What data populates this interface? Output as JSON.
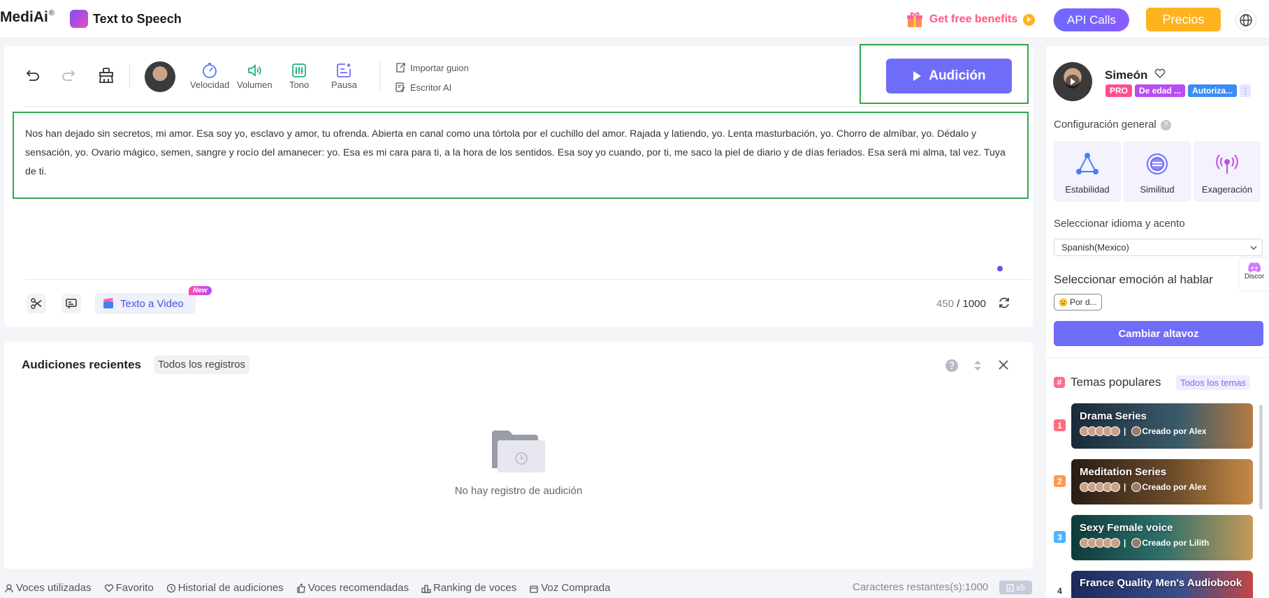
{
  "topbar": {
    "brand": "MediAi",
    "brand_reg": "®",
    "product": "Text to Speech",
    "benefits": "Get free benefits",
    "api_calls": "API Calls",
    "precios": "Precios"
  },
  "toolbar": {
    "velocidad": "Velocidad",
    "volumen": "Volumen",
    "tono": "Tono",
    "pausa": "Pausa",
    "importar": "Importar guion",
    "escritor": "Escritor AI",
    "audicion": "Audición"
  },
  "editor": {
    "text": "Nos han dejado sin secretos, mi amor. Esa soy yo, esclavo y amor, tu ofrenda. Abierta en canal como una tórtola por el cuchillo del amor. Rajada y latiendo, yo. Lenta masturbación, yo. Chorro de almíbar, yo. Dédalo y sensación, yo. Ovario mágico, semen, sangre y rocío del amanecer: yo. Esa es mi cara para ti, a la hora de los sentidos. Esa soy yo cuando, por ti, me saco la piel de diario y de días feriados. Esa será mi alma, tal vez. Tuya de ti.",
    "texto_video": "Texto a Video",
    "new_badge": "New",
    "count": "450",
    "count_sep": " / ",
    "max": "1000"
  },
  "recent": {
    "title": "Audiciones recientes",
    "all": "Todos los registros",
    "empty": "No hay registro de audición"
  },
  "footer": {
    "items": [
      "Voces utilizadas",
      "Favorito",
      "Historial de audiciones",
      "Voces recomendadas",
      "Ranking de voces",
      "Voz Comprada"
    ],
    "remaining": "Caracteres restantes(s):1000",
    "x5": "x5"
  },
  "panel": {
    "speaker_name": "Simeón",
    "badges": [
      "PRO",
      "De edad ...",
      "Autoriza..."
    ],
    "badge_colors": [
      "#ff4d8f",
      "#b84df0",
      "#3a8cf5"
    ],
    "config_label": "Configuración general",
    "cards": [
      "Estabilidad",
      "Similitud",
      "Exageración"
    ],
    "idioma_label": "Seleccionar idioma y acento",
    "idioma_value": "Spanish(Mexico)",
    "emocion_label": "Seleccionar emoción al hablar",
    "emocion_value": "Por d...",
    "cambiar": "Cambiar altavoz",
    "discord": "Discor",
    "temas_title": "Temas populares",
    "temas_all": "Todos los temas",
    "topics": [
      {
        "rank": "1",
        "name": "Drama Series",
        "creator": "Creado por Alex",
        "rank_color": "#ff6b81"
      },
      {
        "rank": "2",
        "name": "Meditation Series",
        "creator": "Creado por Alex",
        "rank_color": "#ff9a4d"
      },
      {
        "rank": "3",
        "name": "Sexy Female voice",
        "creator": "Creado por Lilith",
        "rank_color": "#4db3ff"
      },
      {
        "rank": "4",
        "name": "France Quality Men's Audiobook",
        "creator": "",
        "rank_color": "#ffffff"
      }
    ]
  },
  "colors": {
    "accent": "#6f6df8",
    "highlight_border": "#31a84a",
    "precios": "#ffb31f"
  }
}
